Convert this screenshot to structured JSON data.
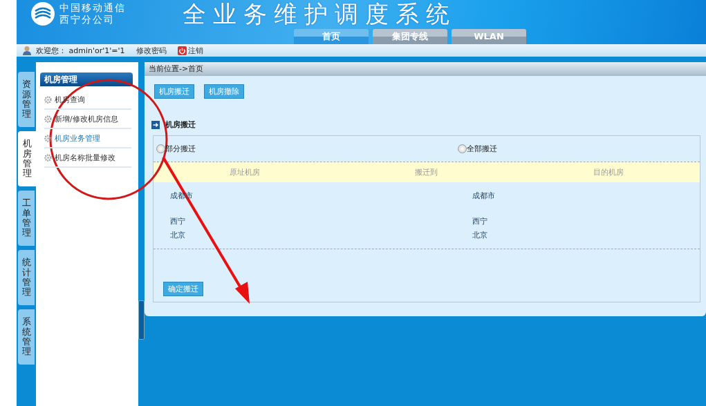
{
  "header": {
    "org_name": [
      "中国移动通信",
      "西宁分公司"
    ],
    "system_title": "全业务维护调度系统",
    "nav_tabs": [
      {
        "label": "首页",
        "selected": true
      },
      {
        "label": "集团专线",
        "selected": false
      },
      {
        "label": "WLAN",
        "selected": false
      }
    ]
  },
  "user_bar": {
    "welcome": "欢迎您： admin'or'1'='1",
    "change_password": "修改密码",
    "logout": "注销"
  },
  "side_tabs": [
    {
      "label": "资源管理",
      "selected": false
    },
    {
      "label": "机房管理",
      "selected": true
    },
    {
      "label": "工单管理",
      "selected": false
    },
    {
      "label": "统计管理",
      "selected": false
    },
    {
      "label": "系统管理",
      "selected": false
    }
  ],
  "menu": {
    "title": "机房管理",
    "items": [
      {
        "label": "机房查询",
        "selected": false
      },
      {
        "label": "新增/修改机房信息",
        "selected": false
      },
      {
        "label": "机房业务管理",
        "selected": true
      },
      {
        "label": "机房名称批量修改",
        "selected": false
      }
    ]
  },
  "breadcrumb": "当前位置->首页",
  "actions": [
    "机房搬迁",
    "机房撤除"
  ],
  "section_title": "机房搬迁",
  "options": [
    {
      "label": "部分搬迁",
      "selected": false
    },
    {
      "label": "全部搬迁",
      "selected": false
    }
  ],
  "table": {
    "columns": [
      "原址机房",
      "搬迁到",
      "目的机房"
    ],
    "groups": [
      {
        "rows": [
          {
            "origin": "成都市",
            "destination": "成都市"
          }
        ]
      },
      {
        "rows": [
          {
            "origin": "西宁",
            "destination": "西宁"
          },
          {
            "origin": "北京",
            "destination": "北京"
          }
        ]
      }
    ]
  },
  "submit": "确定搬迁"
}
